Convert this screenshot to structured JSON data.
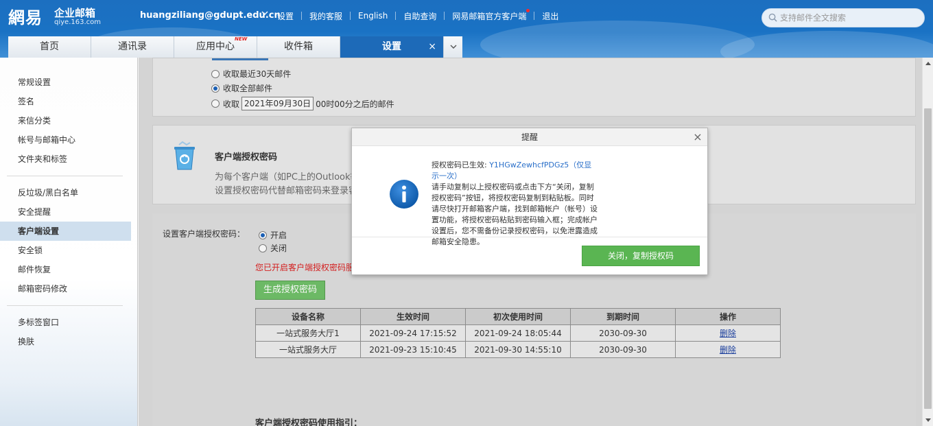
{
  "header": {
    "logo_brand": "網易",
    "logo_cn": "企业邮箱",
    "logo_domain": "qiye.163.com",
    "user_email": "huangziliang@gdupt.edu.cn",
    "nav": [
      "设置",
      "我的客服",
      "English",
      "自助查询",
      "网易邮箱官方客户端",
      "退出"
    ],
    "search_placeholder": "支持邮件全文搜索"
  },
  "tabs": [
    {
      "label": "首页"
    },
    {
      "label": "通讯录"
    },
    {
      "label": "应用中心",
      "badge": "NEW"
    },
    {
      "label": "收件箱"
    },
    {
      "label": "设置",
      "active": true
    }
  ],
  "sidebar": {
    "group1": [
      "常规设置",
      "签名",
      "来信分类",
      "帐号与邮箱中心",
      "文件夹和标签"
    ],
    "group2": [
      "反垃圾/黑白名单",
      "安全提醒",
      "客户端设置",
      "安全锁",
      "邮件恢复",
      "邮箱密码修改"
    ],
    "group3": [
      "多标签窗口",
      "换肤"
    ],
    "active": "客户端设置"
  },
  "pop_section": {
    "opt_recent": "收取最近30天邮件",
    "opt_all": "收取全部邮件",
    "opt_since_prefix": "收取",
    "opt_since_date": "2021年09月30日",
    "opt_since_suffix": "00时00分之后的邮件",
    "selected": "all"
  },
  "auth_section": {
    "title": "客户端授权密码",
    "desc": "为每个客户端（如PC上的Outlook等）设置授权密码代替邮箱密码来登录客户端"
  },
  "auth_settings": {
    "label": "设置客户端授权密码：",
    "opt_on": "开启",
    "opt_off": "关闭",
    "warning": "您已开启客户端授权密码服",
    "gen_button": "生成授权密码",
    "table": {
      "headers": [
        "设备名称",
        "生效时间",
        "初次使用时间",
        "到期时间",
        "操作"
      ],
      "rows": [
        [
          "一站式服务大厅1",
          "2021-09-24 17:15:52",
          "2021-09-24 18:05:44",
          "2030-09-30",
          "删除"
        ],
        [
          "一站式服务大厅",
          "2021-09-23 15:10:45",
          "2021-09-30 14:55:10",
          "2030-09-30",
          "删除"
        ]
      ]
    },
    "guide_title": "客户端授权密码使用指引："
  },
  "dialog": {
    "title": "提醒",
    "line1_prefix": "授权密码已生效: ",
    "code": "Y1HGwZewhcfPDGz5（仅显示一次）",
    "message": "请手动复制以上授权密码或点击下方“关闭，复制授权密码”按钮，将授权密码复制到粘贴板。同时请尽快打开邮箱客户端，找到邮箱帐户（帐号）设置功能，将授权密码粘贴到密码输入框；完成帐户设置后，您不需备份记录授权密码，以免泄露造成邮箱安全隐患。",
    "button": "关闭，复制授权码"
  },
  "colors": {
    "header_blue": "#1a72c4",
    "active_tab": "#1d6ab8",
    "green_button": "#5ab552",
    "warning_red": "#d31e1e",
    "link_blue": "#2a6fc9"
  }
}
